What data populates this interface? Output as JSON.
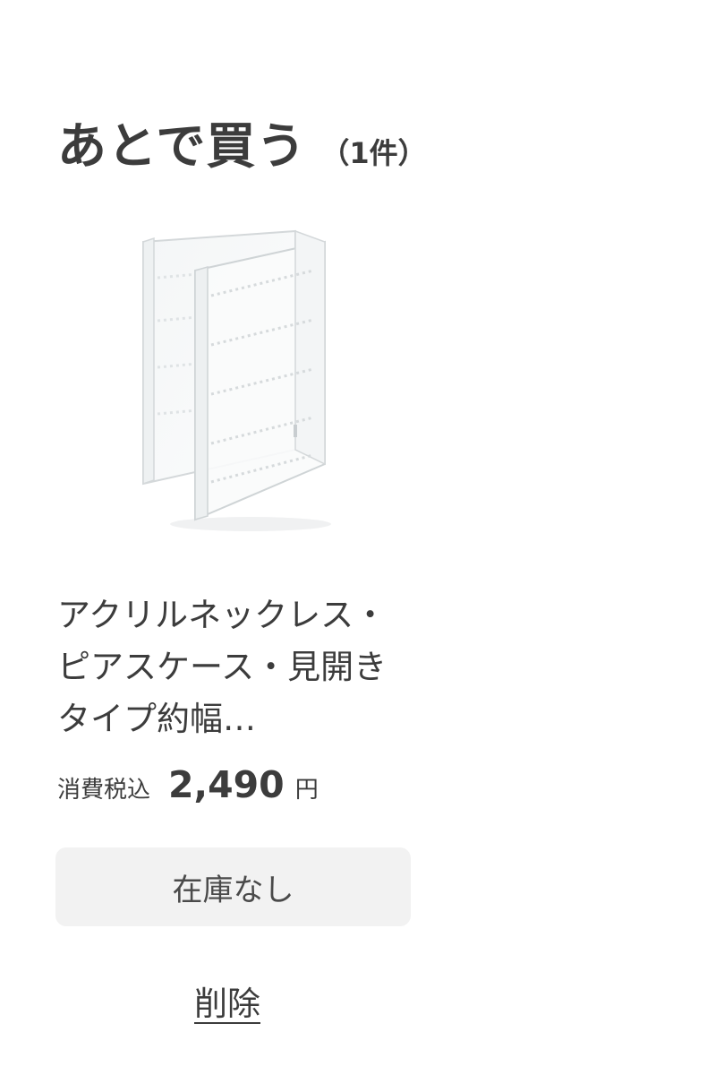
{
  "header": {
    "title": "あとで買う",
    "count": "（1件）"
  },
  "product": {
    "image_icon": "acrylic-jewelry-case-image",
    "name": "アクリルネックレス・ピアスケース・見開きタイプ約幅…",
    "tax_label": "消費税込",
    "price": "2,490",
    "currency": "円",
    "stock_status": "在庫なし",
    "delete_label": "削除"
  },
  "colors": {
    "text": "#3c3c3c",
    "button_bg": "#f2f2f2"
  }
}
